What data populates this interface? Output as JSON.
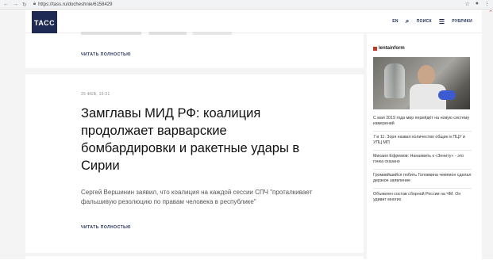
{
  "browser": {
    "url": "https://tass.ru/docheshnie/6158429",
    "lock_icon": "lock-icon"
  },
  "header": {
    "logo": "ТАСС",
    "lang": "EN",
    "search": "ПОИСК",
    "rubrics": "РУБРИКИ",
    "colors": {
      "brand": "#1e2a53"
    }
  },
  "main": {
    "read_more_1": "ЧИТАТЬ ПОЛНОСТЬЮ",
    "article": {
      "date": "25 ФЕВ, 16:21",
      "headline": "Замглавы МИД РФ: коалиция продолжает варварские бомбардировки и ракетные удары в Сирии",
      "lead": "Сергей Вершинин заявил, что коалиция на каждой сессии СПЧ \"проталкивает фальшивую резолюцию по правам человека в республике\"",
      "read_more": "ЧИТАТЬ ПОЛНОСТЬЮ"
    }
  },
  "sidebar": {
    "brand": "lentainform",
    "items": [
      "С мая 2019 года мир перейдёт на новую систему измерений",
      "7 и 11: Зоря назвал количество общин в ПЦУ и УПЦ МП",
      "Михаил Ефремов: Нанаявить к «Зениту» - это гонка сказано",
      "Громивйшийся побить Головкина чемпион сделал дерзкое заявление",
      "Объявлен состав сборной России на ЧМ. Он удивит многих"
    ]
  }
}
